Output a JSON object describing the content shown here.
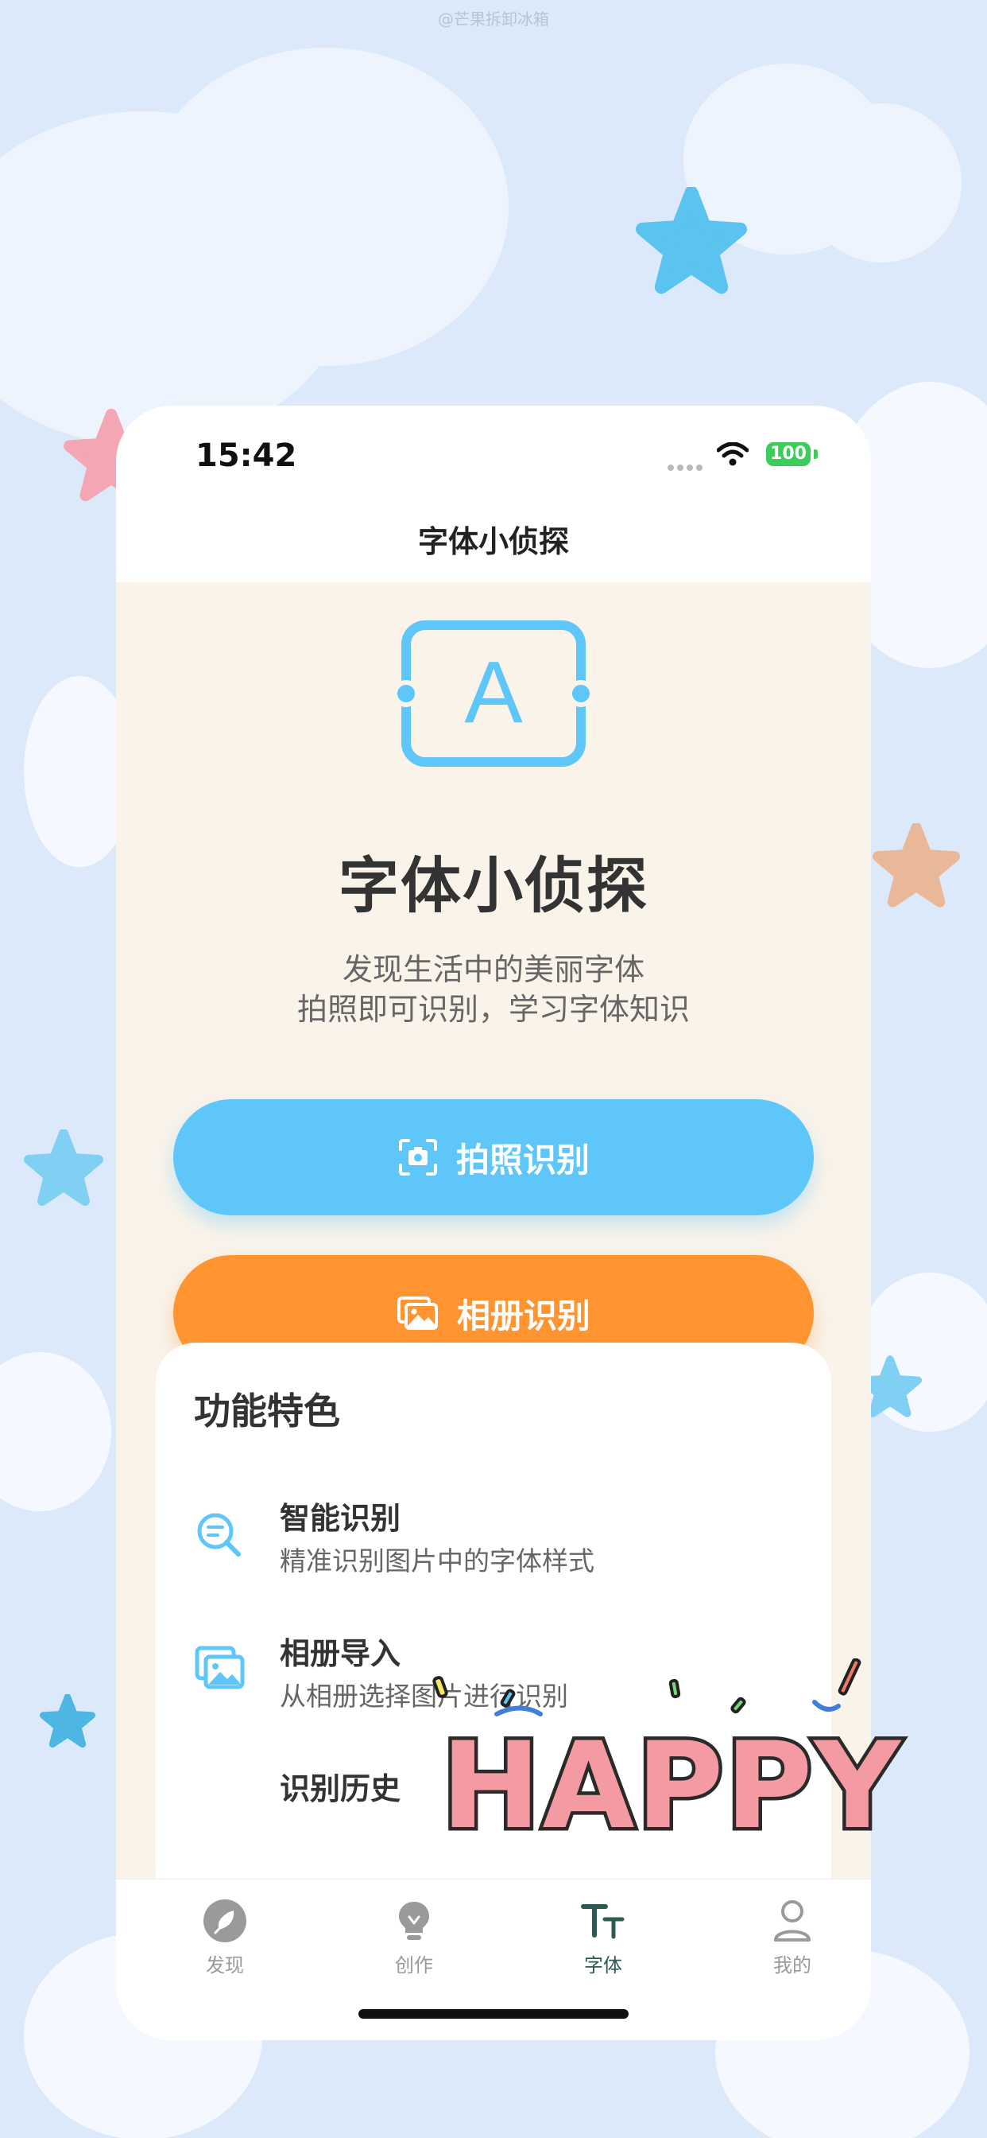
{
  "watermark": "@芒果拆卸冰箱",
  "status": {
    "time": "15:42",
    "battery": "100"
  },
  "nav": {
    "title": "字体小侦探"
  },
  "hero": {
    "logo_letter": "A",
    "title": "字体小侦探",
    "subtitle_line1": "发现生活中的美丽字体",
    "subtitle_line2": "拍照即可识别，学习字体知识"
  },
  "actions": {
    "camera_label": "拍照识别",
    "album_label": "相册识别"
  },
  "features": {
    "title": "功能特色",
    "items": [
      {
        "title": "智能识别",
        "desc": "精准识别图片中的字体样式",
        "icon": "search-text-icon"
      },
      {
        "title": "相册导入",
        "desc": "从相册选择图片进行识别",
        "icon": "image-album-icon"
      },
      {
        "title": "识别历史",
        "desc": "",
        "icon": "history-icon"
      }
    ]
  },
  "tabs": [
    {
      "label": "发现",
      "icon": "compass-icon",
      "active": false
    },
    {
      "label": "创作",
      "icon": "lightbulb-icon",
      "active": false
    },
    {
      "label": "字体",
      "icon": "font-icon",
      "active": true
    },
    {
      "label": "我的",
      "icon": "user-icon",
      "active": false
    }
  ],
  "sticker": {
    "text": "HAPPY"
  },
  "colors": {
    "primary_blue": "#5ec6f8",
    "primary_orange": "#ff9431",
    "content_bg": "#f9f3ea",
    "active_tab": "#2c5b52"
  }
}
